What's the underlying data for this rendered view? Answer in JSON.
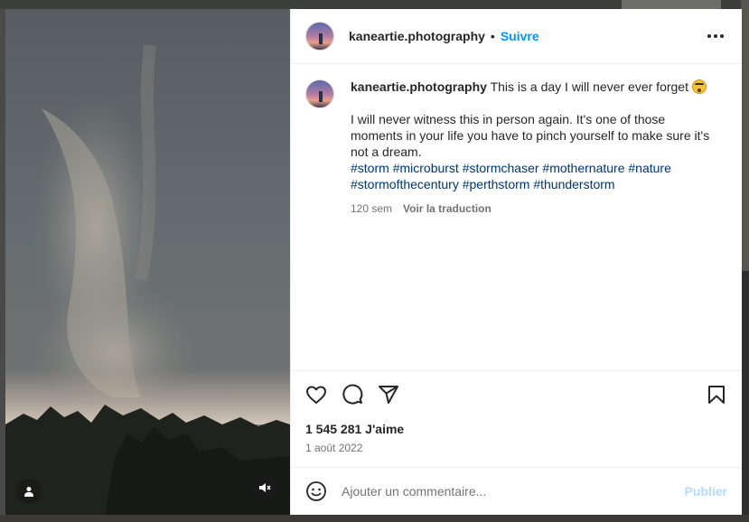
{
  "post": {
    "author": "kaneartie.photography",
    "separator": "•",
    "follow_label": "Suivre",
    "caption_first": "This is a day I will never ever forget",
    "caption_body": "I will never witness this in person again. It's one of those moments in your life you have to pinch yourself to make sure it's not a dream.",
    "hashtags": [
      "#storm",
      "#microburst",
      "#stormchaser",
      "#mothernature",
      "#nature",
      "#stormofthecentury",
      "#perthstorm",
      "#thunderstorm"
    ],
    "age": "120 sem",
    "translate_label": "Voir la traduction",
    "likes": "1 545 281 J'aime",
    "date": "1 août 2022"
  },
  "comment": {
    "placeholder": "Ajouter un commentaire...",
    "publish_label": "Publier"
  },
  "icons": {
    "more": "more-horizontal-icon",
    "like": "heart-icon",
    "comment": "comment-bubble-icon",
    "share": "paper-plane-icon",
    "save": "bookmark-icon",
    "emoji": "smiley-icon",
    "tagged_users": "user-icon",
    "audio": "muted-speaker-icon"
  },
  "colors": {
    "follow": "#0095f6",
    "hashtag": "#00376b",
    "publish_disabled": "#b3dbff"
  }
}
